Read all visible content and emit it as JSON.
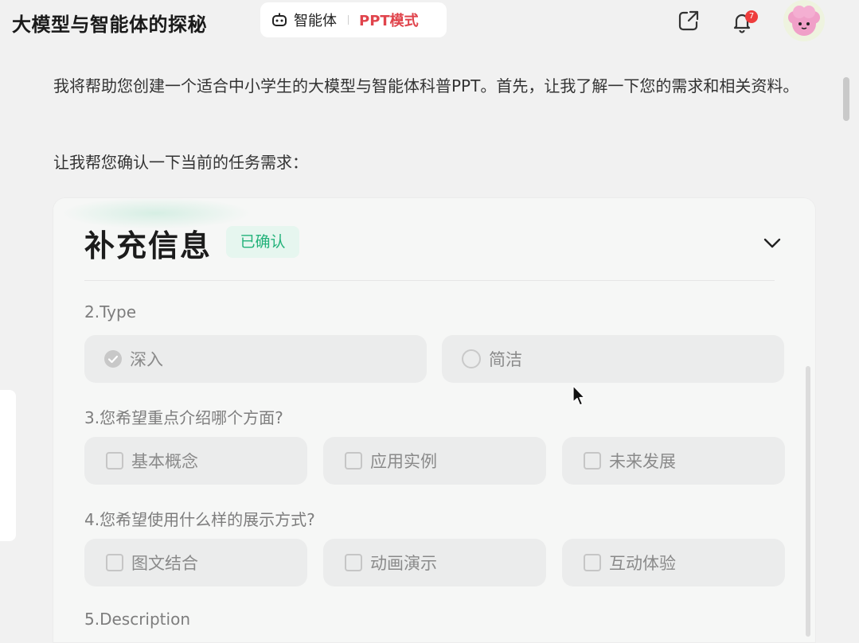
{
  "header": {
    "title": "大模型与智能体的探秘",
    "agent_label": "智能体",
    "mode_label": "PPT模式",
    "notification_count": "7"
  },
  "messages": {
    "intro": "我将帮助您创建一个适合中小学生的大模型与智能体科普PPT。首先，让我了解一下您的需求和相关资料。",
    "confirm_prompt": "让我帮您确认一下当前的任务需求："
  },
  "card": {
    "title": "补充信息",
    "status_badge": "已确认",
    "questions": [
      {
        "label": "2.Type",
        "kind": "radio",
        "options": [
          {
            "label": "深入",
            "selected": true
          },
          {
            "label": "简洁",
            "selected": false
          }
        ]
      },
      {
        "label": "3.您希望重点介绍哪个方面?",
        "kind": "checkbox",
        "options": [
          {
            "label": "基本概念",
            "selected": false
          },
          {
            "label": "应用实例",
            "selected": false
          },
          {
            "label": "未来发展",
            "selected": false
          }
        ]
      },
      {
        "label": "4.您希望使用什么样的展示方式?",
        "kind": "checkbox",
        "options": [
          {
            "label": "图文结合",
            "selected": false
          },
          {
            "label": "动画演示",
            "selected": false
          },
          {
            "label": "互动体验",
            "selected": false
          }
        ]
      },
      {
        "label": "5.Description",
        "kind": "text"
      }
    ]
  },
  "colors": {
    "accent_red": "#e0444c",
    "confirmed_green": "#23b27a",
    "badge_red": "#ee3d3d"
  },
  "icons": {
    "agent": "robot-icon",
    "share": "share-icon",
    "notification": "bell-icon",
    "collapse": "chevron-down-icon"
  }
}
